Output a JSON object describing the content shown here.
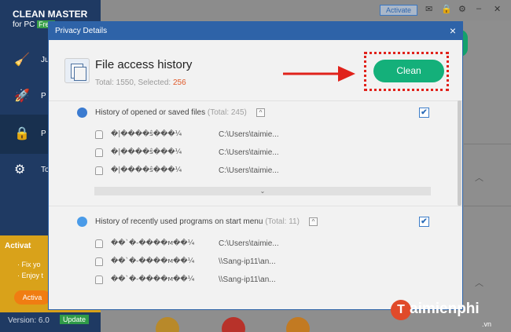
{
  "app": {
    "brand": "CLEAN MASTER",
    "brand_sub": "for PC",
    "brand_badge": "Free",
    "nav": [
      {
        "label": "Ju",
        "icon": "broom-icon"
      },
      {
        "label": "P",
        "icon": "rocket-icon"
      },
      {
        "label": "P",
        "icon": "lock-icon"
      },
      {
        "label": "To",
        "icon": "gears-icon"
      }
    ],
    "promo_title": "Activat",
    "promo_line1": "· Fix yo",
    "promo_line2": "· Enjoy t",
    "promo_button": "Activa",
    "version": "Version: 6.0",
    "update": "Update",
    "activate": "Activate"
  },
  "dialog": {
    "title": "Privacy Details",
    "close": "×",
    "header_title": "File access history",
    "stats_prefix": "Total: 1550, Selected: ",
    "stats_selected": "256",
    "clean_button": "Clean"
  },
  "sections": [
    {
      "label": "History of opened or saved files",
      "total": "(Total: 245)",
      "toggle": "^",
      "checked": "✔",
      "items": [
        {
          "name": "�|����ŝ���¼",
          "path": "C:\\Users\\taimie..."
        },
        {
          "name": "�|����ŝ���¼",
          "path": "C:\\Users\\taimie..."
        },
        {
          "name": "�|����ŝ���¼",
          "path": "C:\\Users\\taimie..."
        }
      ],
      "more": "⌄"
    },
    {
      "label": "History of recently used programs on start menu",
      "total": "(Total: 11)",
      "toggle": "^",
      "checked": "✔",
      "items": [
        {
          "name": "��`�-����м��¼",
          "path": "C:\\Users\\taimie..."
        },
        {
          "name": "��`�-����м��¼",
          "path": "\\\\Sang-ip11\\an..."
        },
        {
          "name": "��`�-����м��¼",
          "path": "\\\\Sang-ip11\\an..."
        }
      ],
      "more": "⌄"
    }
  ],
  "watermark": {
    "letter": "T",
    "text": "aimienphi",
    "domain": ".vn"
  },
  "colors": {
    "titlebar": "#2e63a8",
    "clean": "#14b07a",
    "highlight": "#e0221b",
    "selected": "#e05a2a"
  }
}
